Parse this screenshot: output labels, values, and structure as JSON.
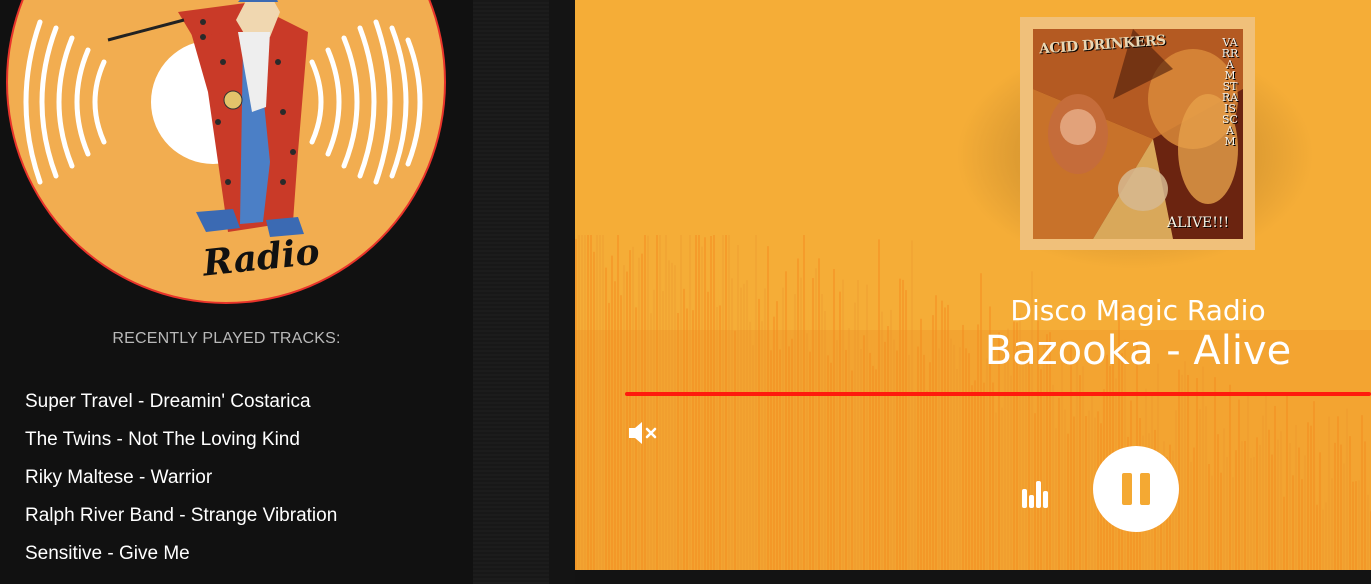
{
  "sidebar": {
    "logo_text": "Radio",
    "recent_heading": "RECENTLY PLAYED TRACKS:",
    "tracks": [
      "Super Travel - Dreamin' Costarica",
      "The Twins - Not The Loving Kind",
      "Riky Maltese - Warrior",
      "Ralph River Band - Strange Vibration",
      "Sensitive - Give Me"
    ]
  },
  "player": {
    "station_name": "Disco Magic Radio",
    "now_playing": "Bazooka - Alive",
    "album_art": {
      "band_text": "ACID DRINKERS",
      "side_text": "VARRAM STRAIS SCAM",
      "title_text": "ALIVE!!!"
    },
    "icons": {
      "mute": "volume-mute-icon",
      "history": "bar-chart-icon",
      "play": "pause-icon"
    },
    "colors": {
      "background": "#f5ad37",
      "progress": "#ff1a0d",
      "sidebar": "#111111"
    }
  }
}
